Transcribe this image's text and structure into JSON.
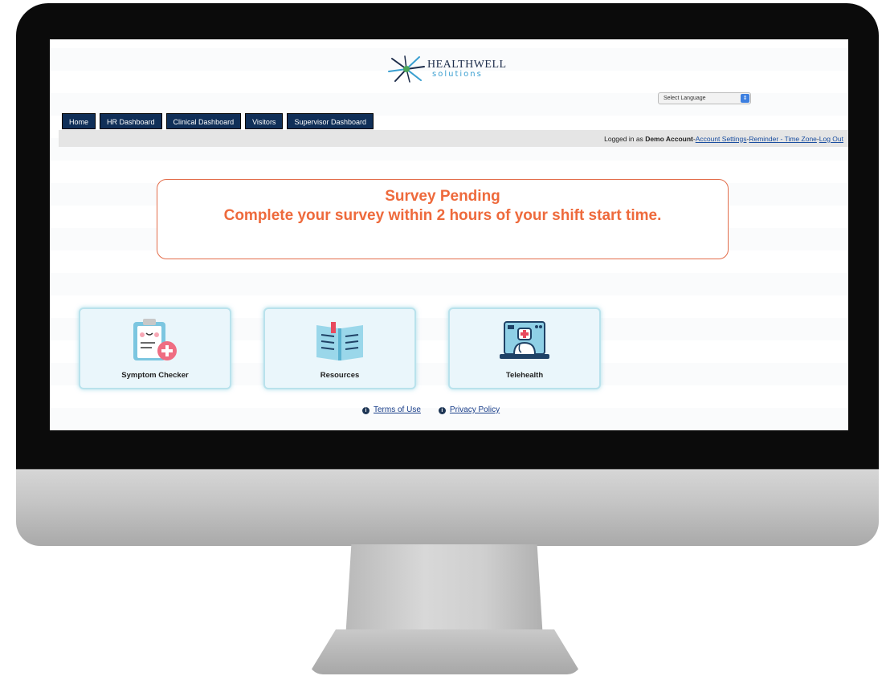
{
  "logo": {
    "name": "HEALTHWELL",
    "sub": "solutions"
  },
  "language": {
    "label": "Select Language",
    "arrow": "⇕"
  },
  "nav": [
    {
      "label": "Home"
    },
    {
      "label": "HR Dashboard"
    },
    {
      "label": "Clinical Dashboard"
    },
    {
      "label": "Visitors"
    },
    {
      "label": "Supervisor Dashboard"
    }
  ],
  "userbar": {
    "prefix": "Logged in as",
    "user": "Demo Account",
    "sep1": " - ",
    "account_settings": "Account Settings",
    "sep2": " - ",
    "reminder": "Reminder - Time Zone",
    "sep3": " - ",
    "logout": "Log Out"
  },
  "alert": {
    "title": "Survey Pending",
    "message": "Complete your survey within 2 hours of your shift start time."
  },
  "tiles": [
    {
      "label": "Symptom Checker",
      "icon": "clipboard-medical-icon"
    },
    {
      "label": "Resources",
      "icon": "open-book-icon"
    },
    {
      "label": "Telehealth",
      "icon": "doctor-monitor-icon"
    }
  ],
  "footer": {
    "info_glyph": "i",
    "terms": "Terms of Use",
    "privacy": "Privacy Policy"
  },
  "colors": {
    "nav_bg": "#102f58",
    "alert_text": "#ee6a3c",
    "alert_border": "#e36d4a",
    "tile_bg": "#eaf6fb"
  }
}
